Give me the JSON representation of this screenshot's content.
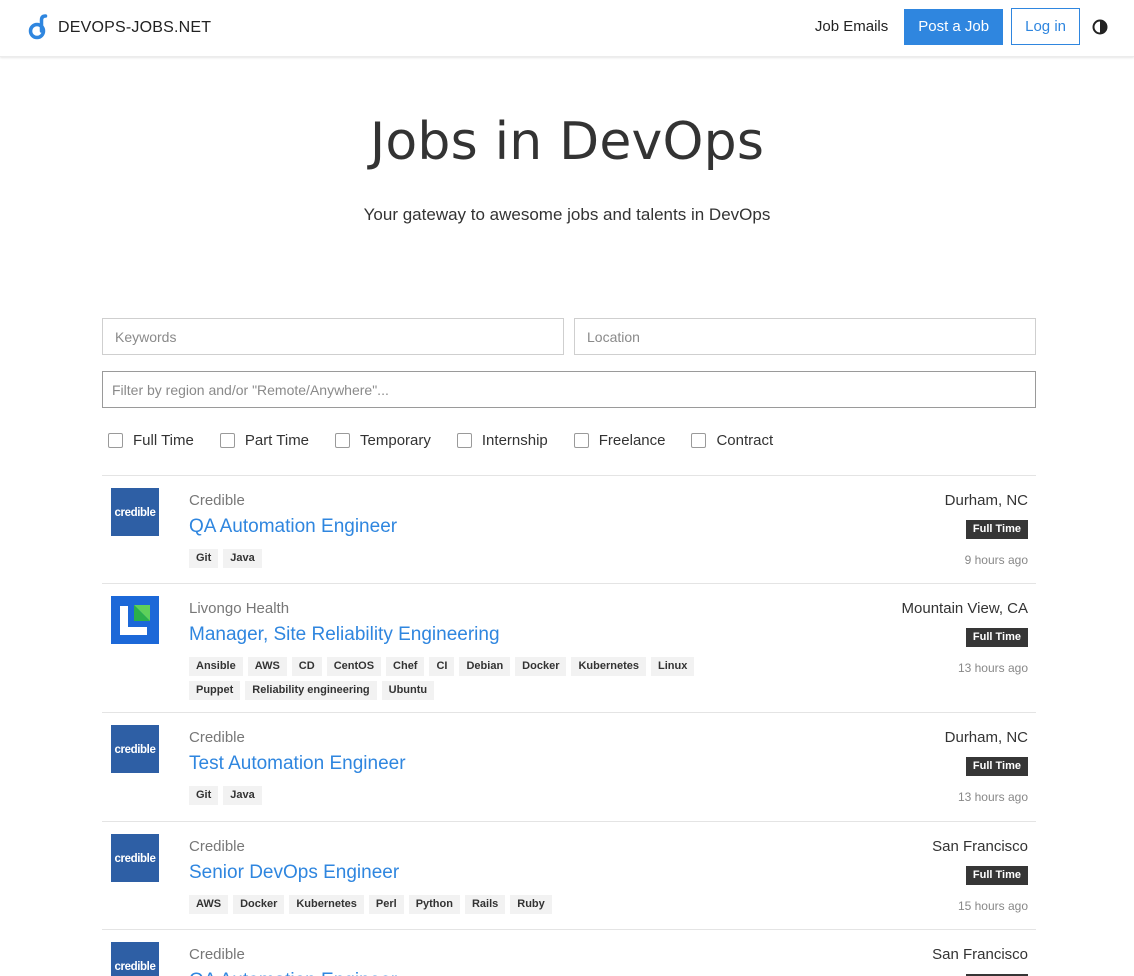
{
  "nav": {
    "brand": "DEVOPS-JOBS.NET",
    "job_emails": "Job Emails",
    "post_job": "Post a Job",
    "login": "Log in",
    "theme_icon": "contrast-icon",
    "accent_color": "#2f86df"
  },
  "hero": {
    "title": "Jobs in DevOps",
    "subtitle": "Your gateway to awesome jobs and talents in DevOps"
  },
  "search": {
    "keywords_placeholder": "Keywords",
    "location_placeholder": "Location",
    "region_placeholder": "Filter by region and/or \"Remote/Anywhere\"..."
  },
  "filters": [
    "Full Time",
    "Part Time",
    "Temporary",
    "Internship",
    "Freelance",
    "Contract"
  ],
  "jobs": [
    {
      "company": "Credible",
      "logo": "credible",
      "title": "QA Automation Engineer",
      "tags": [
        "Git",
        "Java"
      ],
      "location": "Durham, NC",
      "type": "Full Time",
      "time": "9 hours ago"
    },
    {
      "company": "Livongo Health",
      "logo": "livongo",
      "title": "Manager, Site Reliability Engineering",
      "tags": [
        "Ansible",
        "AWS",
        "CD",
        "CentOS",
        "Chef",
        "CI",
        "Debian",
        "Docker",
        "Kubernetes",
        "Linux",
        "Puppet",
        "Reliability engineering",
        "Ubuntu"
      ],
      "location": "Mountain View, CA",
      "type": "Full Time",
      "time": "13 hours ago"
    },
    {
      "company": "Credible",
      "logo": "credible",
      "title": "Test Automation Engineer",
      "tags": [
        "Git",
        "Java"
      ],
      "location": "Durham, NC",
      "type": "Full Time",
      "time": "13 hours ago"
    },
    {
      "company": "Credible",
      "logo": "credible",
      "title": "Senior DevOps Engineer",
      "tags": [
        "AWS",
        "Docker",
        "Kubernetes",
        "Perl",
        "Python",
        "Rails",
        "Ruby"
      ],
      "location": "San Francisco",
      "type": "Full Time",
      "time": "15 hours ago"
    },
    {
      "company": "Credible",
      "logo": "credible",
      "title": "QA Automation Engineer",
      "tags": [],
      "location": "San Francisco",
      "type": "Full Time",
      "time": ""
    }
  ]
}
